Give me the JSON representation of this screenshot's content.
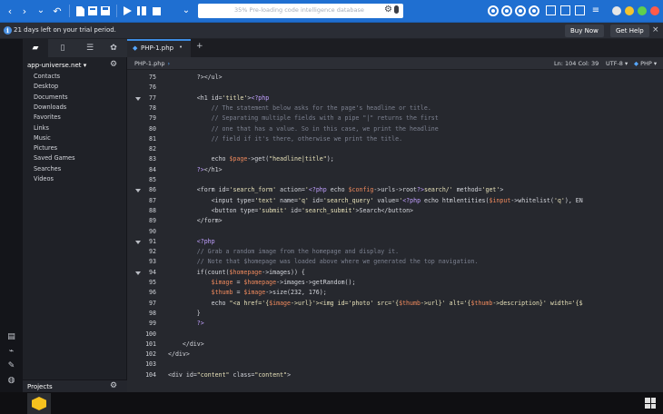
{
  "toolbar": {
    "search_placeholder": "35% Pre-loading code intelligence database",
    "icons": [
      "back-arrow-icon",
      "forward-arrow-icon",
      "undo-icon",
      "new-file-icon",
      "open-file-icon",
      "save-icon",
      "run-icon",
      "debug-icon",
      "stop-icon",
      "dropdown-icon",
      "gear-icon",
      "mic-icon"
    ],
    "accent": "#1f6fd1"
  },
  "trial": {
    "message": "21 days left on your trial period.",
    "buy_label": "Buy Now",
    "help_label": "Get Help",
    "close": "×"
  },
  "sidebar": {
    "project": "app-universe.net",
    "project_caret": "▾",
    "items": [
      "Contacts",
      "Desktop",
      "Documents",
      "Downloads",
      "Favorites",
      "Links",
      "Music",
      "Pictures",
      "Saved Games",
      "Searches",
      "Videos"
    ],
    "bottom_label": "Projects"
  },
  "editor": {
    "tab_label": "PHP-1.php",
    "tab_modified": "•",
    "breadcrumb": "PHP-1.php",
    "position": "Ln: 104 Col: 39",
    "encoding": "UTF-8",
    "language": "PHP",
    "lines": [
      {
        "n": "75",
        "fold": false
      },
      {
        "n": "76",
        "fold": false
      },
      {
        "n": "77",
        "fold": true
      },
      {
        "n": "78",
        "fold": false
      },
      {
        "n": "79",
        "fold": false
      },
      {
        "n": "80",
        "fold": false
      },
      {
        "n": "81",
        "fold": false
      },
      {
        "n": "82",
        "fold": false
      },
      {
        "n": "83",
        "fold": false
      },
      {
        "n": "84",
        "fold": false
      },
      {
        "n": "85",
        "fold": false
      },
      {
        "n": "86",
        "fold": true
      },
      {
        "n": "87",
        "fold": false
      },
      {
        "n": "88",
        "fold": false
      },
      {
        "n": "89",
        "fold": false
      },
      {
        "n": "90",
        "fold": false
      },
      {
        "n": "91",
        "fold": true
      },
      {
        "n": "92",
        "fold": false
      },
      {
        "n": "93",
        "fold": false
      },
      {
        "n": "94",
        "fold": true
      },
      {
        "n": "95",
        "fold": false
      },
      {
        "n": "96",
        "fold": false
      },
      {
        "n": "97",
        "fold": false
      },
      {
        "n": "98",
        "fold": false
      },
      {
        "n": "99",
        "fold": false
      },
      {
        "n": "100",
        "fold": false
      },
      {
        "n": "101",
        "fold": false
      },
      {
        "n": "102",
        "fold": false
      },
      {
        "n": "103",
        "fold": false
      },
      {
        "n": "104",
        "fold": false
      }
    ],
    "code": [
      [
        [
          "        ?></ul>",
          "tag"
        ]
      ],
      [
        [
          "",
          "tag"
        ]
      ],
      [
        [
          "        <h1 ",
          "tag"
        ],
        [
          "id",
          "attr"
        ],
        [
          "=",
          "tag"
        ],
        [
          "'title'",
          "str"
        ],
        [
          ">",
          "tag"
        ],
        [
          "<?php",
          "php"
        ]
      ],
      [
        [
          "            // The statement below asks for the page's headline or title.",
          "cm"
        ]
      ],
      [
        [
          "            // Separating multiple fields with a pipe \"|\" returns the first",
          "cm"
        ]
      ],
      [
        [
          "            // one that has a value. So in this case, we print the headline",
          "cm"
        ]
      ],
      [
        [
          "            // field if it's there, otherwise we print the title.",
          "cm"
        ]
      ],
      [
        [
          "",
          "tag"
        ]
      ],
      [
        [
          "            echo ",
          "kw"
        ],
        [
          "$page",
          "var"
        ],
        [
          "->get(",
          "fn"
        ],
        [
          "\"headline|title\"",
          "str"
        ],
        [
          ");",
          "fn"
        ]
      ],
      [
        [
          "        ",
          "tag"
        ],
        [
          "?>",
          "php"
        ],
        [
          "</h1>",
          "tag"
        ]
      ],
      [
        [
          "",
          "tag"
        ]
      ],
      [
        [
          "        <form ",
          "tag"
        ],
        [
          "id",
          "attr"
        ],
        [
          "=",
          "tag"
        ],
        [
          "'search_form'",
          "str"
        ],
        [
          " action",
          "attr"
        ],
        [
          "=",
          "tag"
        ],
        [
          "'",
          "str"
        ],
        [
          "<?php",
          "php"
        ],
        [
          " echo ",
          "kw"
        ],
        [
          "$config",
          "var"
        ],
        [
          "->urls->root",
          "fn"
        ],
        [
          "?>",
          "php"
        ],
        [
          "search/'",
          "str"
        ],
        [
          " method",
          "attr"
        ],
        [
          "=",
          "tag"
        ],
        [
          "'get'",
          "str"
        ],
        [
          ">",
          "tag"
        ]
      ],
      [
        [
          "            <input ",
          "tag"
        ],
        [
          "type",
          "attr"
        ],
        [
          "=",
          "tag"
        ],
        [
          "'text'",
          "str"
        ],
        [
          " name",
          "attr"
        ],
        [
          "=",
          "tag"
        ],
        [
          "'q'",
          "str"
        ],
        [
          " id",
          "attr"
        ],
        [
          "=",
          "tag"
        ],
        [
          "'search_query'",
          "str"
        ],
        [
          " value",
          "attr"
        ],
        [
          "=",
          "tag"
        ],
        [
          "'",
          "str"
        ],
        [
          "<?php",
          "php"
        ],
        [
          " echo htmlentities(",
          "kw"
        ],
        [
          "$input",
          "var"
        ],
        [
          "->whitelist(",
          "fn"
        ],
        [
          "'q'",
          "str"
        ],
        [
          "), EN",
          "fn"
        ]
      ],
      [
        [
          "            <button ",
          "tag"
        ],
        [
          "type",
          "attr"
        ],
        [
          "=",
          "tag"
        ],
        [
          "'submit'",
          "str"
        ],
        [
          " id",
          "attr"
        ],
        [
          "=",
          "tag"
        ],
        [
          "'search_submit'",
          "str"
        ],
        [
          ">Search</button>",
          "tag"
        ]
      ],
      [
        [
          "        </form>",
          "tag"
        ]
      ],
      [
        [
          "",
          "tag"
        ]
      ],
      [
        [
          "        ",
          "tag"
        ],
        [
          "<?php",
          "php"
        ]
      ],
      [
        [
          "        // Grab a random image from the homepage and display it.",
          "cm"
        ]
      ],
      [
        [
          "        // Note that $homepage was loaded above where we generated the top navigation.",
          "cm"
        ]
      ],
      [
        [
          "        if(count(",
          "kw"
        ],
        [
          "$homepage",
          "var"
        ],
        [
          "->images)) {",
          "fn"
        ]
      ],
      [
        [
          "            ",
          "tag"
        ],
        [
          "$image",
          "var"
        ],
        [
          " = ",
          "fn"
        ],
        [
          "$homepage",
          "var"
        ],
        [
          "->images->getRandom();",
          "fn"
        ]
      ],
      [
        [
          "            ",
          "tag"
        ],
        [
          "$thumb",
          "var"
        ],
        [
          " = ",
          "fn"
        ],
        [
          "$image",
          "var"
        ],
        [
          "->size(232, 176);",
          "fn"
        ]
      ],
      [
        [
          "            echo ",
          "kw"
        ],
        [
          "\"<a href='{",
          "str"
        ],
        [
          "$image",
          "var"
        ],
        [
          "->url}'><img id='photo' src='{",
          "str"
        ],
        [
          "$thumb",
          "var"
        ],
        [
          "->url}' alt='{",
          "str"
        ],
        [
          "$thumb",
          "var"
        ],
        [
          "->description}' width='{$",
          "str"
        ]
      ],
      [
        [
          "        }",
          "fn"
        ]
      ],
      [
        [
          "        ",
          "tag"
        ],
        [
          "?>",
          "php"
        ]
      ],
      [
        [
          "",
          "tag"
        ]
      ],
      [
        [
          "    </div>",
          "tag"
        ]
      ],
      [
        [
          "</div>",
          "tag"
        ]
      ],
      [
        [
          "",
          "tag"
        ]
      ],
      [
        [
          "<div ",
          "tag"
        ],
        [
          "id",
          "attr"
        ],
        [
          "=",
          "tag"
        ],
        [
          "\"content\"",
          "str"
        ],
        [
          " class",
          "attr"
        ],
        [
          "=",
          "tag"
        ],
        [
          "\"content\"",
          "str"
        ],
        [
          ">",
          "tag"
        ]
      ]
    ]
  }
}
